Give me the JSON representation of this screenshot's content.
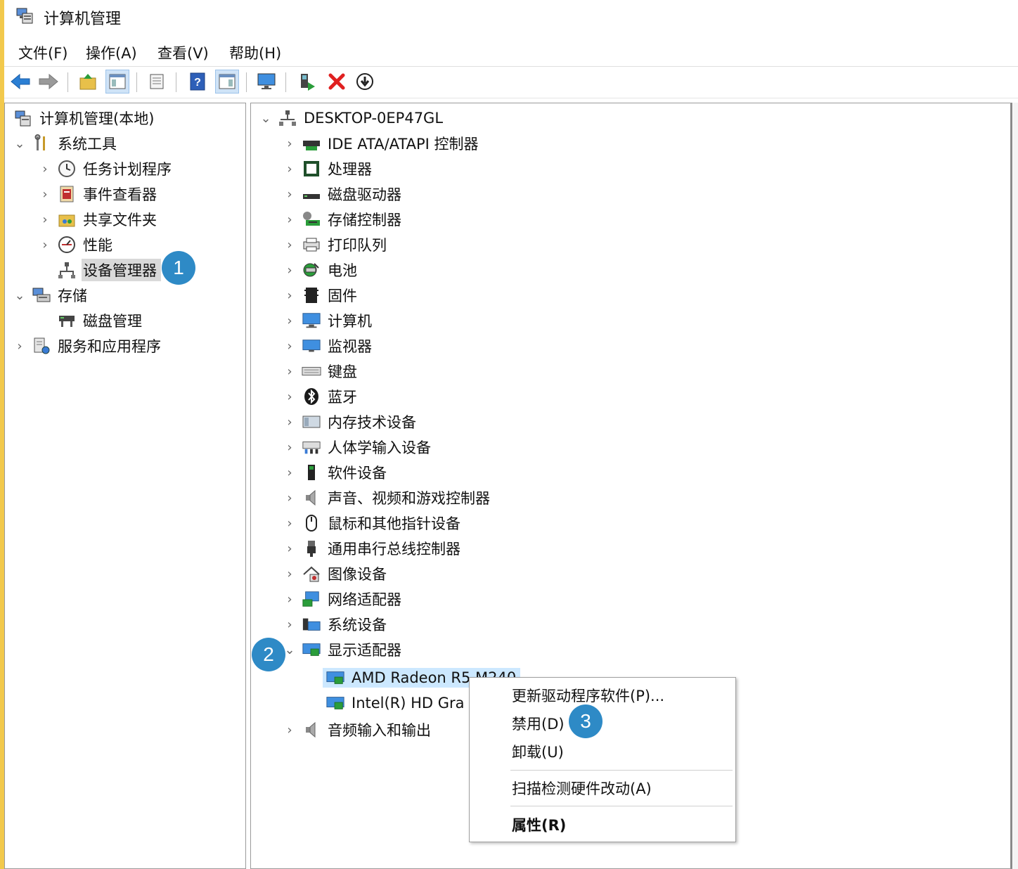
{
  "window": {
    "title": "计算机管理"
  },
  "menu": [
    "文件(F)",
    "操作(A)",
    "查看(V)",
    "帮助(H)"
  ],
  "left_tree": {
    "root": "计算机管理(本地)",
    "system_tools": "系统工具",
    "task_scheduler": "任务计划程序",
    "event_viewer": "事件查看器",
    "shared_folders": "共享文件夹",
    "performance": "性能",
    "device_manager": "设备管理器",
    "storage": "存储",
    "disk_management": "磁盘管理",
    "services_apps": "服务和应用程序"
  },
  "device_tree": {
    "computer": "DESKTOP-0EP47GL",
    "categories": [
      "IDE ATA/ATAPI 控制器",
      "处理器",
      "磁盘驱动器",
      "存储控制器",
      "打印队列",
      "电池",
      "固件",
      "计算机",
      "监视器",
      "键盘",
      "蓝牙",
      "内存技术设备",
      "人体学输入设备",
      "软件设备",
      "声音、视频和游戏控制器",
      "鼠标和其他指针设备",
      "通用串行总线控制器",
      "图像设备",
      "网络适配器",
      "系统设备",
      "显示适配器"
    ],
    "display_children": [
      "AMD Radeon R5 M240",
      "Intel(R) HD Gra"
    ],
    "last_category": "音频输入和输出"
  },
  "context_menu": {
    "update": "更新驱动程序软件(P)...",
    "disable": "禁用(D)",
    "uninstall": "卸载(U)",
    "scan": "扫描检测硬件改动(A)",
    "properties": "属性(R)"
  },
  "badges": [
    "1",
    "2",
    "3"
  ],
  "colors": {
    "badge": "#2e8ac6",
    "selection": "#cce8ff",
    "frame": "#f2c94c"
  }
}
